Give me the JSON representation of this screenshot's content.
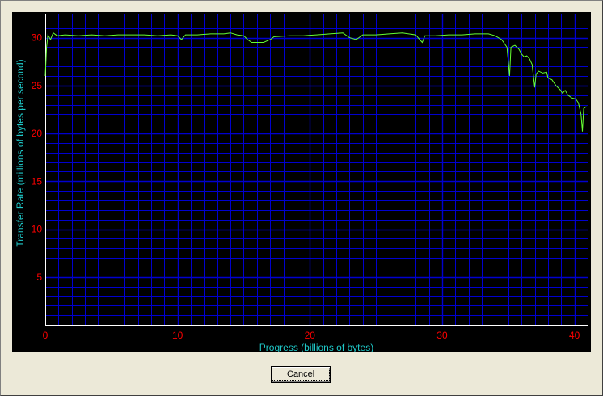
{
  "buttons": {
    "cancel_label": "Cancel"
  },
  "colors": {
    "background": "#000000",
    "grid": "#0000d0",
    "axis": "#ffffff",
    "tick_label": "#ff0000",
    "axis_label": "#1fc8c8",
    "series": "#66ff33"
  },
  "chart_data": {
    "type": "line",
    "title": "",
    "xlabel": "Progress (billions of bytes)",
    "ylabel": "Transfer Rate (millions of bytes per second)",
    "xlim": [
      0,
      41
    ],
    "ylim": [
      0,
      32.5
    ],
    "xticks": [
      0,
      10,
      20,
      30,
      40
    ],
    "yticks": [
      5,
      10,
      15,
      20,
      25,
      30
    ],
    "x_minor_step": 1,
    "y_minor_step": 1,
    "grid": true,
    "series": [
      {
        "values": [
          [
            0.0,
            26.0
          ],
          [
            0.1,
            29.0
          ],
          [
            0.2,
            30.3
          ],
          [
            0.4,
            29.8
          ],
          [
            0.6,
            30.5
          ],
          [
            0.9,
            30.2
          ],
          [
            1.5,
            30.3
          ],
          [
            2.5,
            30.2
          ],
          [
            3.5,
            30.3
          ],
          [
            4.5,
            30.2
          ],
          [
            5.5,
            30.3
          ],
          [
            6.5,
            30.3
          ],
          [
            7.5,
            30.3
          ],
          [
            8.5,
            30.2
          ],
          [
            9.5,
            30.3
          ],
          [
            10.0,
            30.2
          ],
          [
            10.3,
            29.8
          ],
          [
            10.6,
            30.3
          ],
          [
            11.5,
            30.3
          ],
          [
            12.5,
            30.4
          ],
          [
            13.5,
            30.4
          ],
          [
            14.0,
            30.5
          ],
          [
            14.5,
            30.3
          ],
          [
            15.0,
            30.2
          ],
          [
            15.3,
            29.8
          ],
          [
            15.6,
            29.5
          ],
          [
            16.5,
            29.5
          ],
          [
            17.0,
            29.8
          ],
          [
            17.3,
            30.1
          ],
          [
            18.5,
            30.2
          ],
          [
            19.5,
            30.2
          ],
          [
            20.5,
            30.3
          ],
          [
            21.5,
            30.4
          ],
          [
            22.5,
            30.5
          ],
          [
            23.0,
            30.0
          ],
          [
            23.5,
            29.8
          ],
          [
            24.0,
            30.3
          ],
          [
            25.0,
            30.3
          ],
          [
            26.0,
            30.4
          ],
          [
            27.0,
            30.5
          ],
          [
            28.0,
            30.3
          ],
          [
            28.5,
            29.5
          ],
          [
            28.7,
            30.2
          ],
          [
            29.5,
            30.2
          ],
          [
            30.5,
            30.3
          ],
          [
            31.5,
            30.3
          ],
          [
            32.5,
            30.4
          ],
          [
            33.5,
            30.4
          ],
          [
            34.0,
            30.2
          ],
          [
            34.5,
            29.8
          ],
          [
            34.9,
            29.0
          ],
          [
            35.0,
            27.5
          ],
          [
            35.1,
            26.0
          ],
          [
            35.2,
            29.0
          ],
          [
            35.5,
            29.2
          ],
          [
            35.8,
            28.8
          ],
          [
            36.0,
            28.3
          ],
          [
            36.2,
            28.0
          ],
          [
            36.4,
            28.1
          ],
          [
            36.6,
            27.8
          ],
          [
            36.8,
            27.2
          ],
          [
            36.9,
            26.0
          ],
          [
            37.0,
            24.8
          ],
          [
            37.1,
            26.2
          ],
          [
            37.3,
            26.5
          ],
          [
            37.6,
            26.3
          ],
          [
            37.9,
            26.4
          ],
          [
            38.0,
            25.8
          ],
          [
            38.3,
            25.6
          ],
          [
            38.6,
            25.0
          ],
          [
            38.9,
            24.6
          ],
          [
            39.1,
            24.2
          ],
          [
            39.3,
            24.5
          ],
          [
            39.5,
            24.0
          ],
          [
            39.8,
            23.7
          ],
          [
            40.1,
            23.6
          ],
          [
            40.3,
            23.2
          ],
          [
            40.5,
            22.0
          ],
          [
            40.6,
            20.2
          ],
          [
            40.7,
            22.6
          ],
          [
            40.9,
            22.8
          ]
        ]
      }
    ]
  }
}
